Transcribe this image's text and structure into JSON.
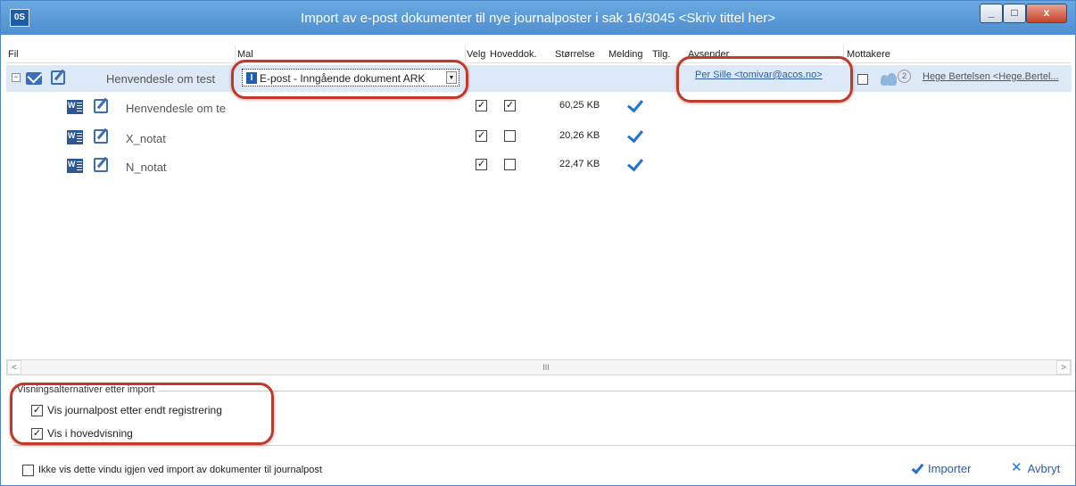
{
  "window": {
    "app_icon_label": "0S",
    "title": "Import av e-post dokumenter til nye journalposter i sak 16/3045 <Skriv tittel her>",
    "minimize_label": "_",
    "maximize_label": "□",
    "close_label": "x"
  },
  "columns": {
    "fil": "Fil",
    "mal": "Mal",
    "velg": "Velg",
    "hoveddok": "Hoveddok.",
    "storrelse": "Størrelse",
    "melding": "Melding",
    "tilg": "Tilg.",
    "avsender": "Avsender",
    "mottakere": "Mottakere"
  },
  "group": {
    "collapse_label": "−",
    "label": "Henvendesle om test",
    "template": "E-post - Inngående dokument ARK",
    "template_badge": "I",
    "template_dropdown": "▼",
    "sender": "Per Sille <tomivar@acos.no>",
    "recipient_count": "2",
    "recipient": "Hege Bertelsen <Hege.Bertel..."
  },
  "files": [
    {
      "name": "Henvendesle om te",
      "velg": true,
      "hoveddok": true,
      "size": "60,25 KB"
    },
    {
      "name": "X_notat",
      "velg": true,
      "hoveddok": false,
      "size": "20,26 KB"
    },
    {
      "name": "N_notat",
      "velg": true,
      "hoveddok": false,
      "size": "22,47 KB"
    }
  ],
  "scrollbar": {
    "left": "<",
    "right": ">",
    "thumb": "III"
  },
  "options": {
    "legend": "Visningsalternativer etter import",
    "opt1": "Vis journalpost etter endt registrering",
    "opt2": "Vis i hovedvisning",
    "check": "✓"
  },
  "footer": {
    "dont_show": "Ikke vis dette vindu igjen ved import av dokumenter til journalpost",
    "import": "Importer",
    "cancel": "Avbryt",
    "cancel_mark": "✕"
  },
  "colors": {
    "titlebar": "#5b9bd5",
    "group_row": "#dde9f6",
    "accent": "#1e73d6",
    "annotation": "#c0392b"
  }
}
